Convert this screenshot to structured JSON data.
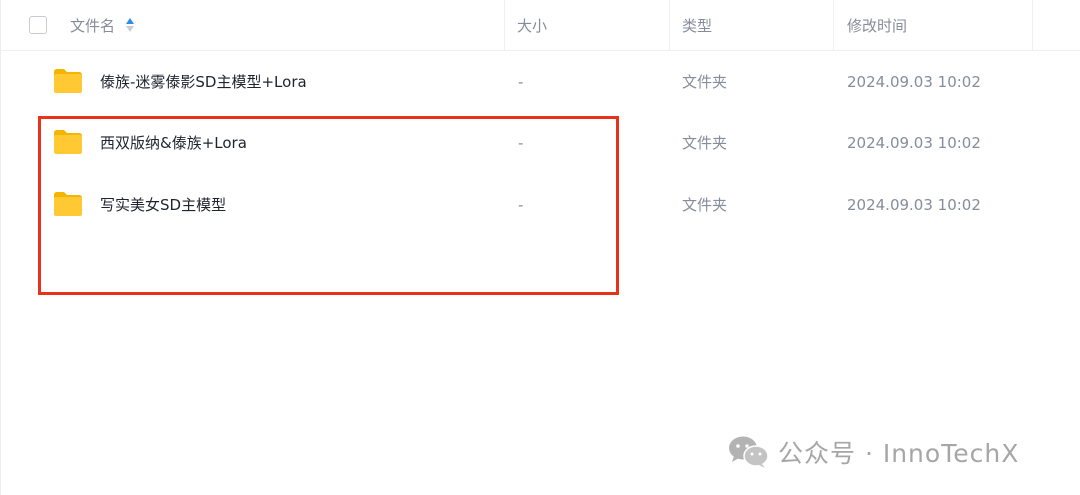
{
  "header": {
    "name_label": "文件名",
    "size_label": "大小",
    "type_label": "类型",
    "modified_label": "修改时间"
  },
  "files": [
    {
      "name": "傣族-迷雾傣影SD主模型+Lora",
      "size": "-",
      "type": "文件夹",
      "modified": "2024.09.03 10:02"
    },
    {
      "name": "西双版纳&傣族+Lora",
      "size": "-",
      "type": "文件夹",
      "modified": "2024.09.03 10:02"
    },
    {
      "name": "写实美女SD主模型",
      "size": "-",
      "type": "文件夹",
      "modified": "2024.09.03 10:02"
    }
  ],
  "watermark": {
    "text": "公众号 · InnoTechX"
  },
  "colors": {
    "highlight_border": "#e8321c",
    "folder_yellow": "#ffc933",
    "sort_active": "#2d8cf0"
  },
  "icons": {
    "folder": "folder-icon",
    "sort": "sort-icon",
    "wechat": "wechat-icon"
  }
}
